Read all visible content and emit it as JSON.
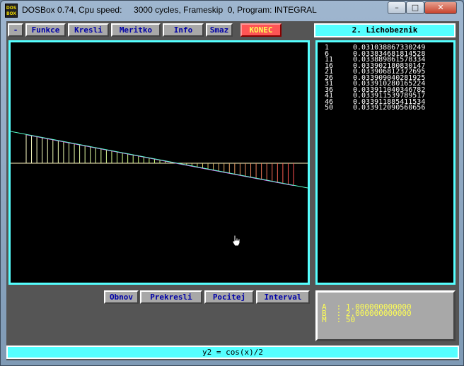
{
  "window": {
    "title": "DOSBox 0.74, Cpu speed:     3000 cycles, Frameskip  0, Program: INTEGRAL",
    "icon_text": "DOS BOX",
    "minimize_glyph": "–",
    "maximize_glyph": "□",
    "close_glyph": "✕"
  },
  "menu": [
    {
      "label": "-"
    },
    {
      "label": "Funkce"
    },
    {
      "label": "Kresli"
    },
    {
      "label": "Meritko"
    },
    {
      "label": "Info"
    },
    {
      "label": "Smaz"
    },
    {
      "label": "KONEC"
    }
  ],
  "method": {
    "title": "2. Lichobeznik"
  },
  "results": [
    {
      "n": "1",
      "value": "0.031038867330249"
    },
    {
      "n": "6",
      "value": "0.033834681814528"
    },
    {
      "n": "11",
      "value": "0.033889861578334"
    },
    {
      "n": "16",
      "value": "0.033902180830147"
    },
    {
      "n": "21",
      "value": "0.033906812372695"
    },
    {
      "n": "26",
      "value": "0.033909040281925"
    },
    {
      "n": "31",
      "value": "0.033910280165224"
    },
    {
      "n": "36",
      "value": "0.033911040346782"
    },
    {
      "n": "41",
      "value": "0.033911539789517"
    },
    {
      "n": "46",
      "value": "0.033911885411534"
    },
    {
      "n": "50",
      "value": "0.033912090560656"
    }
  ],
  "actions": [
    {
      "label": "Obnov"
    },
    {
      "label": "Prekresli"
    },
    {
      "label": "Pocitej"
    },
    {
      "label": "Interval"
    }
  ],
  "params": [
    {
      "key": "A",
      "value": ": 1.000000000000"
    },
    {
      "key": "B",
      "value": ": 2.000000000000"
    },
    {
      "key": "M",
      "value": ": 50"
    }
  ],
  "status": {
    "formula": "y2 = cos(x)/2"
  },
  "plot": {
    "intervals": 50,
    "colors": {
      "axis": "#fff8c0",
      "curve": "#55ffcc",
      "stripe_left": "#ffffff",
      "stripe_right": "#ff4f4f",
      "trap_top": "#ff55ff"
    }
  }
}
